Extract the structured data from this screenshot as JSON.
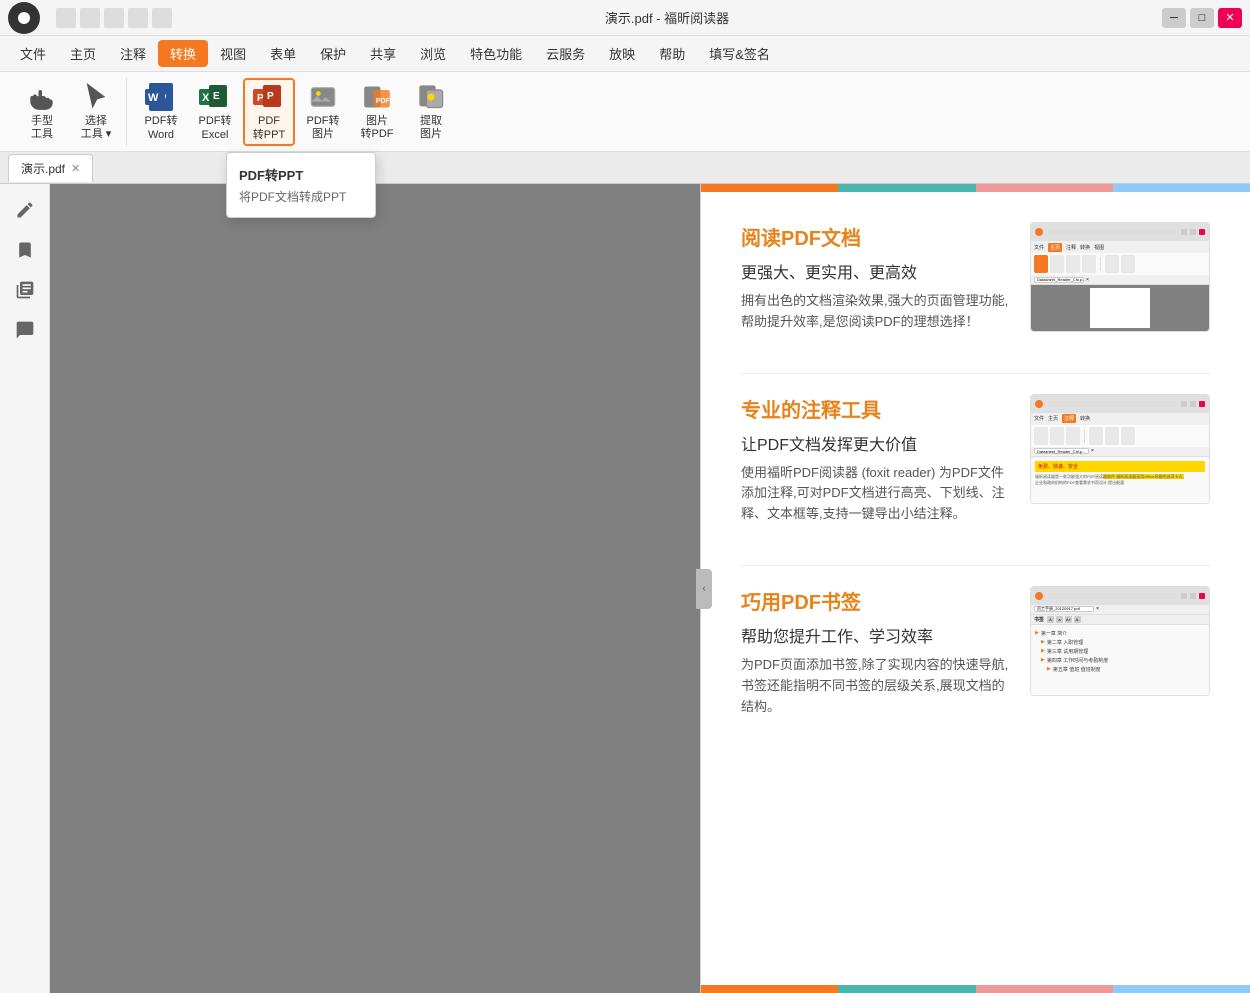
{
  "titlebar": {
    "title": "演示.pdf - 福昕阅读器",
    "controls": [
      "minimize",
      "maximize",
      "close"
    ]
  },
  "menubar": {
    "items": [
      "文件",
      "主页",
      "注释",
      "转换",
      "视图",
      "表单",
      "保护",
      "共享",
      "浏览",
      "特色功能",
      "云服务",
      "放映",
      "帮助",
      "填写&签名"
    ],
    "active": "转换"
  },
  "toolbar": {
    "tools": [
      {
        "id": "hand",
        "label": "手型\n工具",
        "icon": "hand"
      },
      {
        "id": "select",
        "label": "选择\n工具",
        "icon": "cursor",
        "has_dropdown": true
      },
      {
        "id": "pdf-to-word",
        "label": "PDF转\nWord",
        "icon": "word"
      },
      {
        "id": "pdf-to-excel",
        "label": "PDF转\nExcel",
        "icon": "excel"
      },
      {
        "id": "pdf-to-ppt",
        "label": "PDF\n转PPT",
        "icon": "ppt",
        "active": true
      },
      {
        "id": "pdf-to-image",
        "label": "PDF转\n图片",
        "icon": "image"
      },
      {
        "id": "image-to-pdf",
        "label": "图片\n转PDF",
        "icon": "img2pdf"
      },
      {
        "id": "extract-image",
        "label": "提取\n图片",
        "icon": "extract"
      }
    ]
  },
  "tabbar": {
    "tabs": [
      "演示.pdf"
    ]
  },
  "tooltip": {
    "title": "PDF转PPT",
    "description": "将PDF文档转成PPT"
  },
  "preview": {
    "colorbars": [
      {
        "color": "#f47920"
      },
      {
        "color": "#4db6ac"
      },
      {
        "color": "#ef9a9a"
      },
      {
        "color": "#90caf9"
      }
    ],
    "sections": [
      {
        "id": "read",
        "title": "阅读PDF文档",
        "subtitle": "更强大、更实用、更高效",
        "body": "拥有出色的文档渲染效果,强大的页面管理功能,帮助提升效率,是您阅读PDF的理想选择！"
      },
      {
        "id": "annotate",
        "title": "专业的注释工具",
        "subtitle": "让PDF文档发挥更大价值",
        "body": "使用福昕PDF阅读器 (foxit reader) 为PDF文件添加注释,可对PDF文档进行高亮、下划线、注释、文本框等,支持一键导出小结注释。"
      },
      {
        "id": "bookmark",
        "title": "巧用PDF书签",
        "subtitle": "帮助您提升工作、学习效率",
        "body": "为PDF页面添加书签,除了实现内容的快速导航,书签还能指明不同书签的层级关系,展现文档的结构。"
      }
    ],
    "mini_tabs": [
      "Datasheet_Reader_Chi.p...",
      "×"
    ],
    "anno_tab": [
      "Datasheet_Reader_Chi.p...",
      "×"
    ],
    "bm_tab": [
      "员工手册_20120917.pdf",
      "×"
    ],
    "bm_items": [
      "第一章 简介",
      "第二章 入职管理",
      "第三章 试用期管理",
      "第四章 工作时间与考勤制度",
      "第五章 值班 值班制度"
    ]
  },
  "sidebar": {
    "buttons": [
      "edit",
      "bookmark",
      "pages",
      "comment"
    ]
  },
  "collapse_btn": "‹"
}
